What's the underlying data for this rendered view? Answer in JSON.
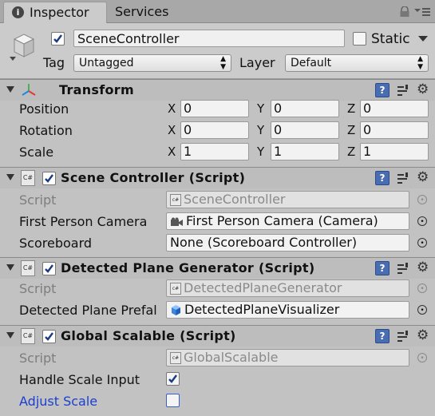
{
  "tabs": [
    {
      "label": "Inspector"
    },
    {
      "label": "Services"
    }
  ],
  "header": {
    "object_name": "SceneController",
    "static_label": "Static",
    "tag_label": "Tag",
    "tag_value": "Untagged",
    "layer_label": "Layer",
    "layer_value": "Default"
  },
  "transform": {
    "title": "Transform",
    "rows": [
      {
        "label": "Position",
        "x": "0",
        "y": "0",
        "z": "0"
      },
      {
        "label": "Rotation",
        "x": "0",
        "y": "0",
        "z": "0"
      },
      {
        "label": "Scale",
        "x": "1",
        "y": "1",
        "z": "1"
      }
    ],
    "axis_x": "X",
    "axis_y": "Y",
    "axis_z": "Z"
  },
  "scene_controller": {
    "title": "Scene Controller (Script)",
    "script_label": "Script",
    "script_value": "SceneController",
    "camera_label": "First Person Camera",
    "camera_value": "First Person Camera (Camera)",
    "scoreboard_label": "Scoreboard",
    "scoreboard_value": "None (Scoreboard Controller)"
  },
  "plane_generator": {
    "title": "Detected Plane Generator (Script)",
    "script_label": "Script",
    "script_value": "DetectedPlaneGenerator",
    "prefab_label": "Detected Plane Prefal",
    "prefab_value": "DetectedPlaneVisualizer"
  },
  "global_scalable": {
    "title": "Global Scalable (Script)",
    "script_label": "Script",
    "script_value": "GlobalScalable",
    "handle_label": "Handle Scale Input",
    "handle_checked": true,
    "adjust_label": "Adjust Scale",
    "adjust_checked": false
  },
  "icons": {
    "tab": "info-icon",
    "lock": "lock-icon",
    "menu": "menu-icon",
    "gameobject": "cube-icon",
    "help": "help-icon",
    "preset": "preset-icon",
    "gear": "gear-icon",
    "script": "cs-script-icon"
  }
}
